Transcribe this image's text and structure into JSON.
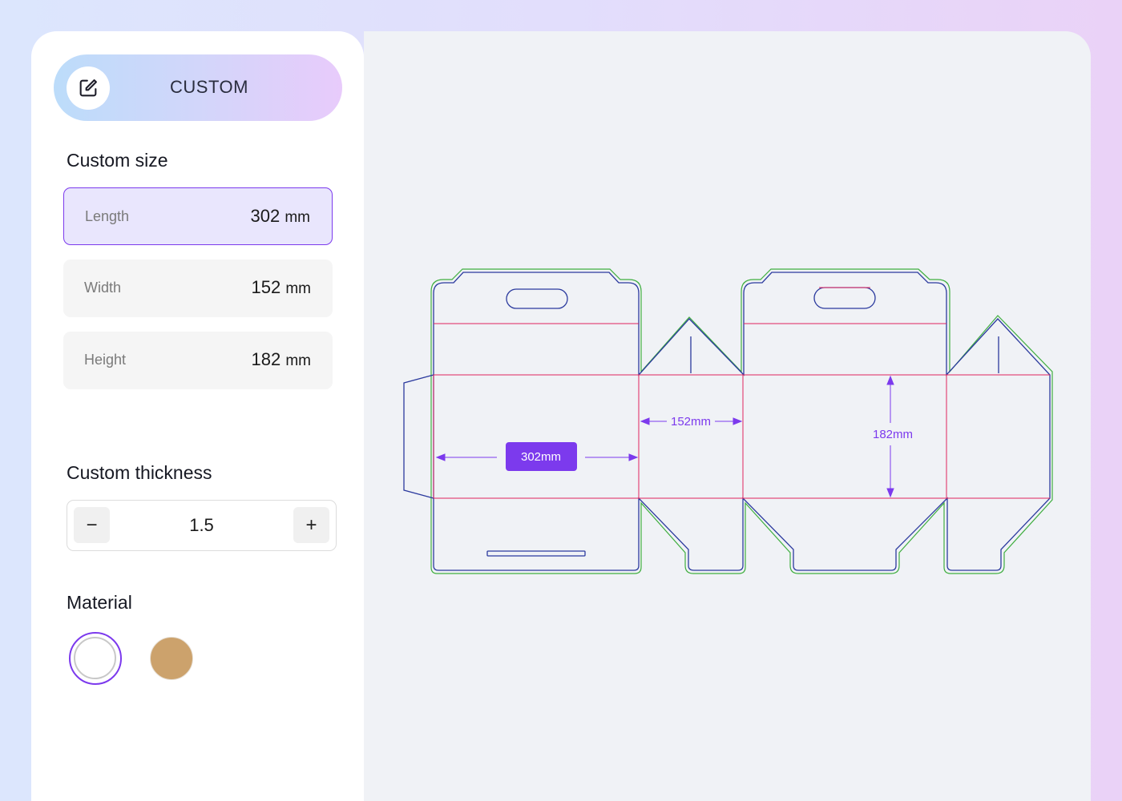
{
  "header": {
    "mode_label": "CUSTOM",
    "mode_icon": "edit-square-icon"
  },
  "custom_size": {
    "title": "Custom size",
    "length": {
      "label": "Length",
      "value": "302",
      "unit": "mm"
    },
    "width": {
      "label": "Width",
      "value": "152",
      "unit": "mm"
    },
    "height": {
      "label": "Height",
      "value": "182",
      "unit": "mm"
    }
  },
  "custom_thickness": {
    "title": "Custom thickness",
    "value": "1.5",
    "decrement_label": "−",
    "increment_label": "+"
  },
  "material": {
    "title": "Material",
    "options": [
      {
        "name": "white",
        "color": "#ffffff",
        "selected": true
      },
      {
        "name": "kraft",
        "color": "#cca26c",
        "selected": false
      }
    ]
  },
  "dieline": {
    "length_label": "302mm",
    "width_label": "152mm",
    "height_label": "182mm",
    "colors": {
      "cut": "#2b3a9e",
      "crease": "#e0245e",
      "bleed": "#3fae3f",
      "dimension": "#7c3aed"
    }
  }
}
